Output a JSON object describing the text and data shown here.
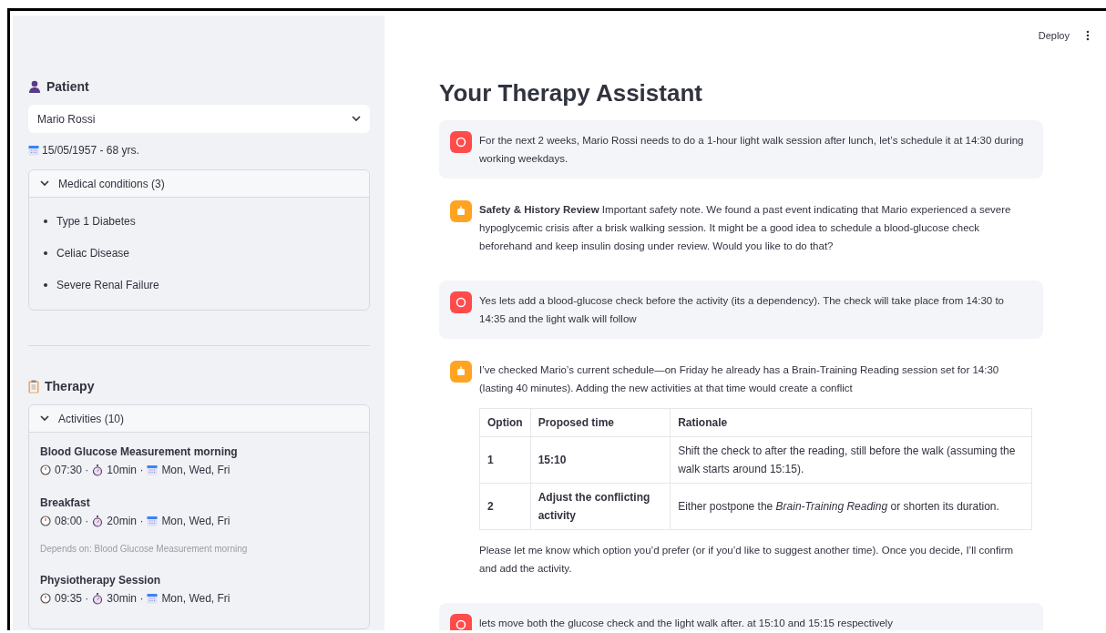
{
  "toolbar": {
    "deploy": "Deploy"
  },
  "sidebar": {
    "patient": {
      "heading": "Patient",
      "select_value": "Mario Rossi",
      "birth": "15/05/1957 - 68 yrs.",
      "conditions": {
        "title": "Medical conditions (3)",
        "expanded": true,
        "items": [
          "Type 1 Diabetes",
          "Celiac Disease",
          "Severe Renal Failure"
        ]
      }
    },
    "therapy": {
      "heading": "Therapy",
      "activities": {
        "title": "Activities (10)",
        "expanded": true,
        "items": [
          {
            "name": "Blood Glucose Measurement morning",
            "time": "07:30 ·",
            "duration": "10min ·",
            "days": "Mon, Wed, Fri"
          },
          {
            "name": "Breakfast",
            "time": "08:00 ·",
            "duration": "20min ·",
            "days": "Mon, Wed, Fri",
            "depends": "Depends on: Blood Glucose Measurement morning"
          },
          {
            "name": "Physiotherapy Session",
            "time": "09:35 ·",
            "duration": "30min ·",
            "days": "Mon, Wed, Fri"
          }
        ]
      }
    }
  },
  "main": {
    "title": "Your Therapy Assistant",
    "messages": [
      {
        "kind": "user",
        "text": "For the next 2 weeks, Mario Rossi needs to do a 1-hour light walk session after lunch, let’s schedule it at 14:30 during working weekdays."
      },
      {
        "kind": "assistant",
        "text": "**Safety & History Review** Important safety note. We found a past event indicating that Mario experienced a severe hypoglycemic crisis after a brisk walking session. It might be a good idea to schedule a blood-glucose check beforehand and keep insulin dosing under review. Would you like to do that?"
      },
      {
        "kind": "user",
        "text": "Yes lets add a blood-glucose check before the activity (its a dependency). The check will take place from 14:30 to 14:35 and the light walk will follow"
      },
      {
        "kind": "assistant",
        "text": "I’ve checked Mario’s current schedule—on Friday he already has a Brain-Training Reading session set for 14:30 (lasting 40 minutes). Adding the new activities at that time would create a conflict",
        "table": {
          "columns": [
            "Option",
            "Proposed time",
            "Rationale"
          ],
          "rows": [
            [
              "1",
              "15:10",
              "Shift the check to after the reading, still before the walk (assuming the walk starts around 15:15)."
            ],
            [
              "2",
              "Adjust the conflicting activity",
              "Either postpone the *Brain-Training Reading* or shorten its duration."
            ]
          ]
        },
        "after": "Please let me know which option you’d prefer (or if you’d like to suggest another time). Once you decide, I’ll confirm and add the activity."
      },
      {
        "kind": "user",
        "text": "lets move both the glucose check and the light walk after. at 15:10 and 15:15 respectively"
      }
    ]
  }
}
